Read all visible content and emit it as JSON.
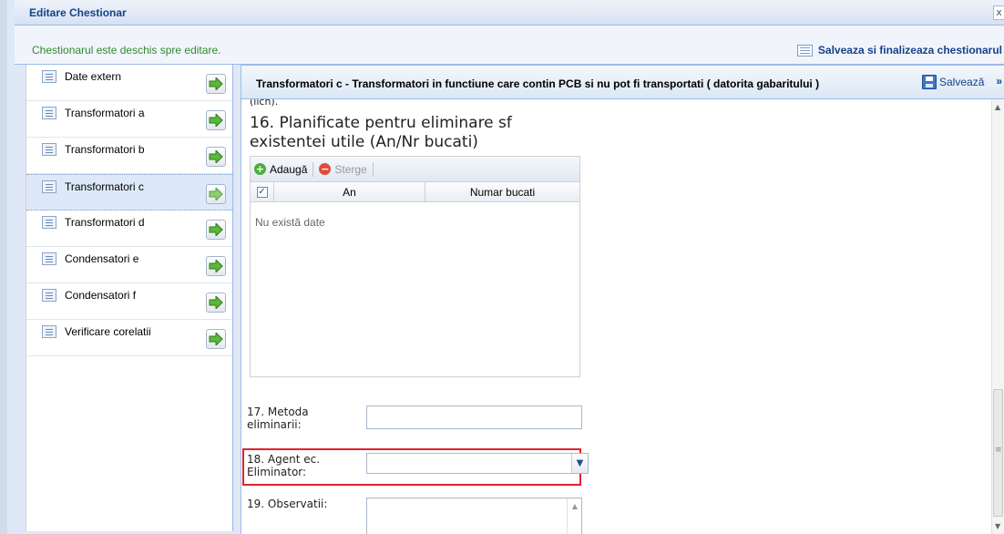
{
  "window": {
    "title": "Editare Chestionar",
    "close_glyph": "x"
  },
  "statusbar": {
    "message": "Chestionarul este deschis spre editare.",
    "finalize_label": "Salveaza si finalizeaza chestionarul"
  },
  "sidebar": {
    "items": [
      {
        "label": "Date extern",
        "icon": "form-icon",
        "action_icon": "green-arrow-icon"
      },
      {
        "label": "Transformatori a",
        "icon": "form-icon",
        "action_icon": "green-arrow-icon"
      },
      {
        "label": "Transformatori b",
        "icon": "form-icon",
        "action_icon": "green-arrow-icon"
      },
      {
        "label": "Transformatori c",
        "icon": "form-icon",
        "action_icon": "green-arrow-icon",
        "selected": true
      },
      {
        "label": "Transformatori d",
        "icon": "form-icon",
        "action_icon": "green-arrow-icon"
      },
      {
        "label": "Condensatori e",
        "icon": "form-icon",
        "action_icon": "green-arrow-icon"
      },
      {
        "label": "Condensatori f",
        "icon": "form-icon",
        "action_icon": "green-arrow-icon"
      },
      {
        "label": "Verificare corelatii",
        "icon": "form-icon",
        "action_icon": "green-arrow-icon"
      }
    ]
  },
  "main": {
    "header_title": "Transformatori c - Transformatori in functiune care contin PCB si nu pot fi transportati ( datorita gabaritului )",
    "save_label": "Salvează",
    "more_glyph": "»",
    "cut_text": "(lich).",
    "q16": {
      "label_line1": "16. Planificate pentru eliminare sf",
      "label_line2": "existentei utile (An/Nr bucati)",
      "add_label": "Adaugă",
      "delete_label": "Sterge",
      "columns": [
        "An",
        "Numar bucati"
      ],
      "empty_text": "Nu există date"
    },
    "q17": {
      "label_line1": "17. Metoda",
      "label_line2": "eliminarii:",
      "value": ""
    },
    "q18": {
      "label_line1": "18. Agent ec.",
      "label_line2": "Eliminator:",
      "value": ""
    },
    "q19": {
      "label": "19. Observatii:",
      "value": ""
    }
  },
  "colors": {
    "accent": "#15428b",
    "status_green": "#2f8a2f",
    "highlight_red": "#e0222f"
  }
}
